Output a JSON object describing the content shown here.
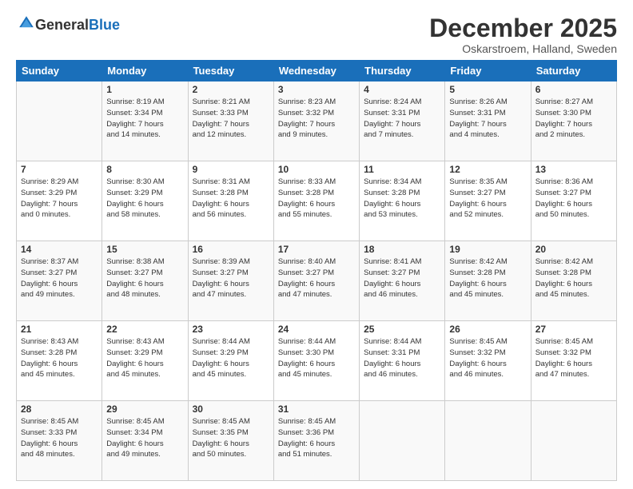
{
  "logo": {
    "general": "General",
    "blue": "Blue"
  },
  "title": "December 2025",
  "subtitle": "Oskarstroem, Halland, Sweden",
  "days_of_week": [
    "Sunday",
    "Monday",
    "Tuesday",
    "Wednesday",
    "Thursday",
    "Friday",
    "Saturday"
  ],
  "weeks": [
    [
      {
        "day": "",
        "info": ""
      },
      {
        "day": "1",
        "info": "Sunrise: 8:19 AM\nSunset: 3:34 PM\nDaylight: 7 hours\nand 14 minutes."
      },
      {
        "day": "2",
        "info": "Sunrise: 8:21 AM\nSunset: 3:33 PM\nDaylight: 7 hours\nand 12 minutes."
      },
      {
        "day": "3",
        "info": "Sunrise: 8:23 AM\nSunset: 3:32 PM\nDaylight: 7 hours\nand 9 minutes."
      },
      {
        "day": "4",
        "info": "Sunrise: 8:24 AM\nSunset: 3:31 PM\nDaylight: 7 hours\nand 7 minutes."
      },
      {
        "day": "5",
        "info": "Sunrise: 8:26 AM\nSunset: 3:31 PM\nDaylight: 7 hours\nand 4 minutes."
      },
      {
        "day": "6",
        "info": "Sunrise: 8:27 AM\nSunset: 3:30 PM\nDaylight: 7 hours\nand 2 minutes."
      }
    ],
    [
      {
        "day": "7",
        "info": "Sunrise: 8:29 AM\nSunset: 3:29 PM\nDaylight: 7 hours\nand 0 minutes."
      },
      {
        "day": "8",
        "info": "Sunrise: 8:30 AM\nSunset: 3:29 PM\nDaylight: 6 hours\nand 58 minutes."
      },
      {
        "day": "9",
        "info": "Sunrise: 8:31 AM\nSunset: 3:28 PM\nDaylight: 6 hours\nand 56 minutes."
      },
      {
        "day": "10",
        "info": "Sunrise: 8:33 AM\nSunset: 3:28 PM\nDaylight: 6 hours\nand 55 minutes."
      },
      {
        "day": "11",
        "info": "Sunrise: 8:34 AM\nSunset: 3:28 PM\nDaylight: 6 hours\nand 53 minutes."
      },
      {
        "day": "12",
        "info": "Sunrise: 8:35 AM\nSunset: 3:27 PM\nDaylight: 6 hours\nand 52 minutes."
      },
      {
        "day": "13",
        "info": "Sunrise: 8:36 AM\nSunset: 3:27 PM\nDaylight: 6 hours\nand 50 minutes."
      }
    ],
    [
      {
        "day": "14",
        "info": "Sunrise: 8:37 AM\nSunset: 3:27 PM\nDaylight: 6 hours\nand 49 minutes."
      },
      {
        "day": "15",
        "info": "Sunrise: 8:38 AM\nSunset: 3:27 PM\nDaylight: 6 hours\nand 48 minutes."
      },
      {
        "day": "16",
        "info": "Sunrise: 8:39 AM\nSunset: 3:27 PM\nDaylight: 6 hours\nand 47 minutes."
      },
      {
        "day": "17",
        "info": "Sunrise: 8:40 AM\nSunset: 3:27 PM\nDaylight: 6 hours\nand 47 minutes."
      },
      {
        "day": "18",
        "info": "Sunrise: 8:41 AM\nSunset: 3:27 PM\nDaylight: 6 hours\nand 46 minutes."
      },
      {
        "day": "19",
        "info": "Sunrise: 8:42 AM\nSunset: 3:28 PM\nDaylight: 6 hours\nand 45 minutes."
      },
      {
        "day": "20",
        "info": "Sunrise: 8:42 AM\nSunset: 3:28 PM\nDaylight: 6 hours\nand 45 minutes."
      }
    ],
    [
      {
        "day": "21",
        "info": "Sunrise: 8:43 AM\nSunset: 3:28 PM\nDaylight: 6 hours\nand 45 minutes."
      },
      {
        "day": "22",
        "info": "Sunrise: 8:43 AM\nSunset: 3:29 PM\nDaylight: 6 hours\nand 45 minutes."
      },
      {
        "day": "23",
        "info": "Sunrise: 8:44 AM\nSunset: 3:29 PM\nDaylight: 6 hours\nand 45 minutes."
      },
      {
        "day": "24",
        "info": "Sunrise: 8:44 AM\nSunset: 3:30 PM\nDaylight: 6 hours\nand 45 minutes."
      },
      {
        "day": "25",
        "info": "Sunrise: 8:44 AM\nSunset: 3:31 PM\nDaylight: 6 hours\nand 46 minutes."
      },
      {
        "day": "26",
        "info": "Sunrise: 8:45 AM\nSunset: 3:32 PM\nDaylight: 6 hours\nand 46 minutes."
      },
      {
        "day": "27",
        "info": "Sunrise: 8:45 AM\nSunset: 3:32 PM\nDaylight: 6 hours\nand 47 minutes."
      }
    ],
    [
      {
        "day": "28",
        "info": "Sunrise: 8:45 AM\nSunset: 3:33 PM\nDaylight: 6 hours\nand 48 minutes."
      },
      {
        "day": "29",
        "info": "Sunrise: 8:45 AM\nSunset: 3:34 PM\nDaylight: 6 hours\nand 49 minutes."
      },
      {
        "day": "30",
        "info": "Sunrise: 8:45 AM\nSunset: 3:35 PM\nDaylight: 6 hours\nand 50 minutes."
      },
      {
        "day": "31",
        "info": "Sunrise: 8:45 AM\nSunset: 3:36 PM\nDaylight: 6 hours\nand 51 minutes."
      },
      {
        "day": "",
        "info": ""
      },
      {
        "day": "",
        "info": ""
      },
      {
        "day": "",
        "info": ""
      }
    ]
  ]
}
